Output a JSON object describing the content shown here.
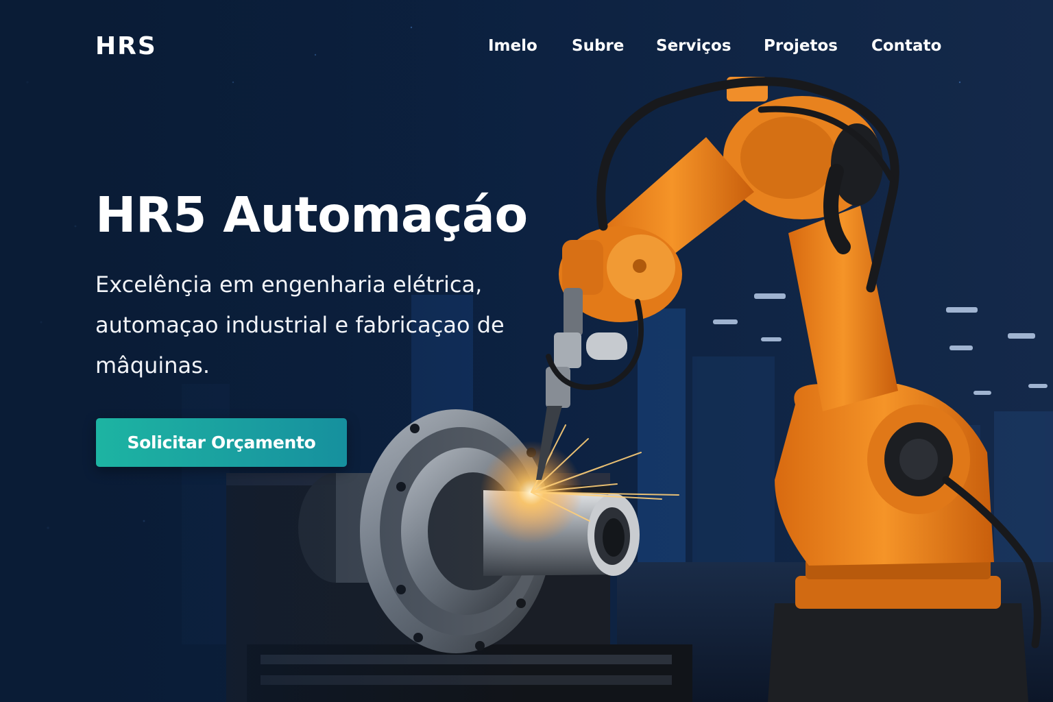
{
  "header": {
    "logo_text": "HRS",
    "nav": [
      {
        "label": "Imelo"
      },
      {
        "label": "Subre"
      },
      {
        "label": "Serviços"
      },
      {
        "label": "Projetos"
      },
      {
        "label": "Contato"
      }
    ]
  },
  "hero": {
    "title": "HR5 Automaçáo",
    "subtitle": "Excelênçia em engenharia elétrica, automaçao industrial e fabricaçao de mâquinas.",
    "cta_label": "Solicitar Orçamento",
    "image_alt": "orange-industrial-robot-arm-welding-metal-flange"
  },
  "colors": {
    "background": "#0a1c36",
    "robot_orange": "#f0851e",
    "button_gradient_start": "#1db4a2",
    "button_gradient_end": "#16909e",
    "text": "#ffffff"
  }
}
